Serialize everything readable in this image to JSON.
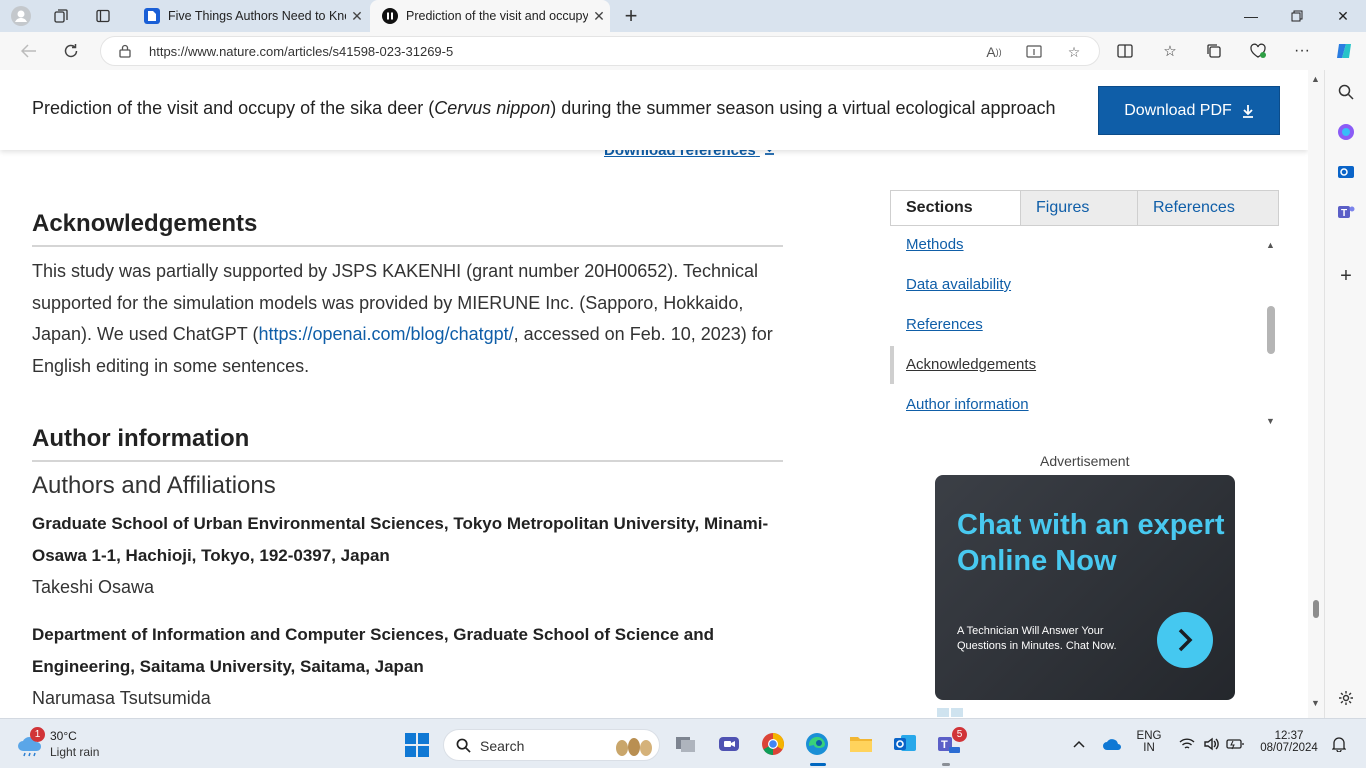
{
  "browser": {
    "tabs": [
      {
        "title": "Five Things Authors Need to Know"
      },
      {
        "title": "Prediction of the visit and occupy of the sika deer"
      }
    ],
    "url": "https://www.nature.com/articles/s41598-023-31269-5"
  },
  "sticky_header": {
    "title_before": "Prediction of the visit and occupy of the sika deer (",
    "title_italic": "Cervus nippon",
    "title_after": ") during the summer season using a virtual ecological approach",
    "download_pdf": "Download PDF"
  },
  "article": {
    "download_references": "Download references",
    "acknowledgements": {
      "heading": "Acknowledgements",
      "text_before": "This study was partially supported by JSPS KAKENHI (grant number 20H00652). Technical supported for the simulation models was provided by MIERUNE Inc. (Sapporo, Hokkaido, Japan). We used ChatGPT (",
      "link": "https://openai.com/blog/chatgpt/",
      "text_after": ", accessed on Feb. 10, 2023) for English editing in some sentences."
    },
    "author_information": {
      "heading": "Author information",
      "subheading": "Authors and Affiliations",
      "affiliations": [
        {
          "name": "Graduate School of Urban Environmental Sciences, Tokyo Metropolitan University, Minami-Osawa 1-1, Hachioji, Tokyo, 192-0397, Japan",
          "person": "Takeshi Osawa"
        },
        {
          "name": "Department of Information and Computer Sciences, Graduate School of Science and Engineering, Saitama University, Saitama, Japan",
          "person": "Narumasa Tsutsumida"
        }
      ]
    }
  },
  "sidebar": {
    "tabs": [
      "Sections",
      "Figures",
      "References"
    ],
    "links": [
      "Methods",
      "Data availability",
      "References",
      "Acknowledgements",
      "Author information"
    ],
    "current": "Acknowledgements"
  },
  "ad": {
    "label": "Advertisement",
    "headline": "Chat with an expert Online Now",
    "subtext": "A Technician Will Answer Your Questions in Minutes. Chat Now."
  },
  "taskbar": {
    "weather_temp": "30°C",
    "weather_cond": "Light rain",
    "weather_badge": "1",
    "search_label": "Search",
    "teams_badge": "5",
    "lang_1": "ENG",
    "lang_2": "IN",
    "time": "12:37",
    "date": "08/07/2024"
  },
  "colors": {
    "accent": "#0f5ea8",
    "ad_accent": "#48c9f0"
  }
}
